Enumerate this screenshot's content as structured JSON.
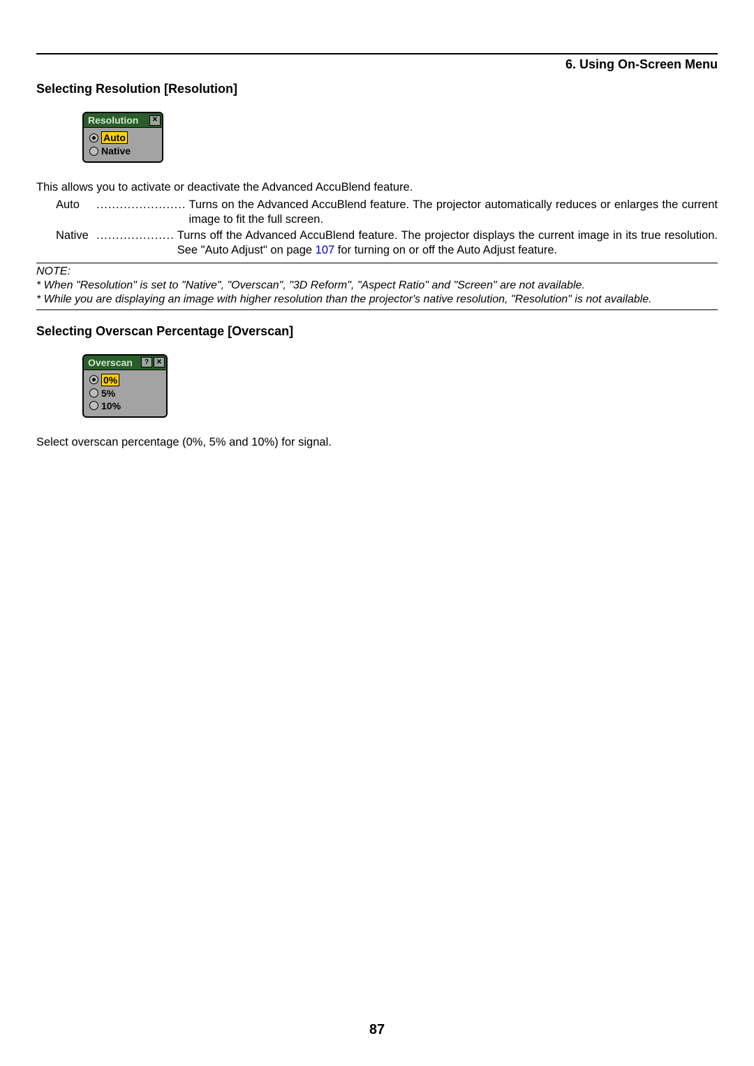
{
  "header": {
    "chapter": "6. Using On-Screen Menu"
  },
  "section1": {
    "heading": "Selecting Resolution [Resolution]",
    "menu": {
      "title": "Resolution",
      "options": [
        "Auto",
        "Native"
      ],
      "selected": "Auto"
    },
    "intro": "This allows you to activate or deactivate the Advanced AccuBlend feature.",
    "defs": {
      "auto": {
        "term": "Auto",
        "dots": ".......................",
        "desc": "Turns on the Advanced AccuBlend feature. The projector automatically reduces or enlarges the current image to fit the full screen."
      },
      "native": {
        "term": "Native",
        "dots": "....................",
        "desc_1": "Turns off the Advanced AccuBlend feature. The projector displays the current image in its true resolution. See \"Auto Adjust\" on page ",
        "desc_link": "107",
        "desc_2": " for turning on or off the Auto Adjust feature."
      }
    },
    "note": {
      "label": "NOTE:",
      "line1": "* When \"Resolution\" is set to \"Native\", \"Overscan\", \"3D Reform\", \"Aspect Ratio\" and \"Screen\" are not available.",
      "line2": "* While you are displaying an image with higher resolution than the projector's native resolution, \"Resolution\" is not available."
    }
  },
  "section2": {
    "heading": "Selecting Overscan Percentage [Overscan]",
    "menu": {
      "title": "Overscan",
      "options": [
        "0%",
        "5%",
        "10%"
      ],
      "selected": "0%"
    },
    "body": "Select overscan percentage (0%, 5% and 10%) for signal."
  },
  "page_number": "87"
}
